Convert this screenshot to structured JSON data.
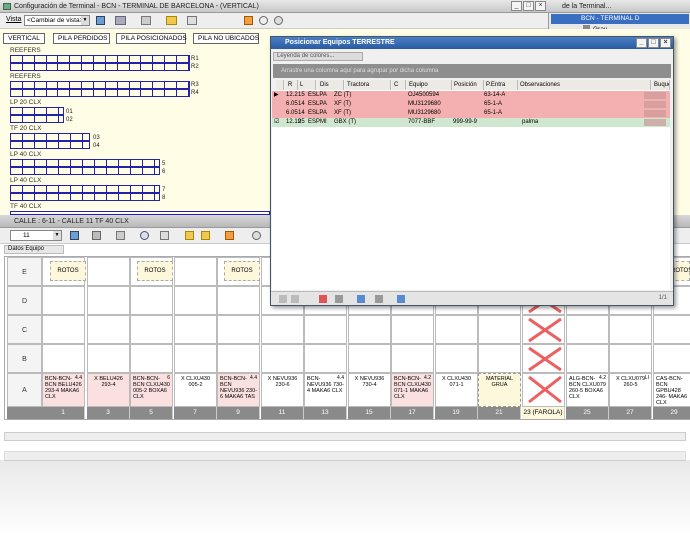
{
  "main_window": {
    "title": "Configuración de Terminal - BCN - TERMINAL DE BARCELONA - (VERTICAL)",
    "view_label": "Vista",
    "view_select": "<Cambiar de vista>"
  },
  "right_window": {
    "title": "de la Terminal...",
    "tree_item": "BCN - TERMINAL D",
    "tree_sub": "Gray"
  },
  "view_buttons": [
    "VERTICAL",
    "PILA PERDIDOS",
    "PILA POSICIONADOS",
    "PILA NO UBICADOS"
  ],
  "piles": [
    {
      "title": "REEFERS",
      "labels": [
        "R1",
        "R2"
      ]
    },
    {
      "title": "REEFERS",
      "labels": [
        "R3",
        "R4"
      ]
    },
    {
      "title": "LP 20 CLX",
      "labels": [
        "01",
        "02"
      ]
    },
    {
      "title": "TF 20 CLX",
      "labels": [
        "03",
        "04"
      ]
    },
    {
      "title": "LP 40 CLX",
      "labels": [
        "5",
        "6"
      ]
    },
    {
      "title": "LP 40 CLX",
      "labels": [
        "7",
        "8"
      ]
    },
    {
      "title": "TF 40 CLX",
      "labels": []
    }
  ],
  "calle": {
    "title": "CALLE : 6-11 - CALLE 11 TF 40 CLX",
    "select_value": "11",
    "datos_equipo": "Datos Equipo"
  },
  "row_labels": [
    "E",
    "D",
    "C",
    "B",
    "A"
  ],
  "rotos_label": "ROTOS",
  "a_row": [
    {
      "text": "BCN-BCN-BCN BELU426 293-4 MAKA6 CLX",
      "badge": "4.4",
      "type": "pink"
    },
    {
      "text": "X BELU426 293-4",
      "badge": "",
      "type": "pink"
    },
    {
      "text": "BCN-BCN-BCN CLXU430 005-2 BOXA6 CLX",
      "badge": "6",
      "type": "pink"
    },
    {
      "text": "X CLXU430 005-2",
      "badge": "",
      "type": "plain"
    },
    {
      "text": "BCN-BCN-BCN NEVU936 230-6 MAKA6 TAS",
      "badge": "4.4",
      "type": "pink"
    },
    {
      "text": "X NEVU936 230-6",
      "badge": "",
      "type": "plain"
    },
    {
      "text": "BCN- NEVU936 730-4 MAKA6 CLX",
      "badge": "4.4",
      "type": "plain"
    },
    {
      "text": "X NEVU936 730-4",
      "badge": "",
      "type": "plain"
    },
    {
      "text": "BCN-BCN-BCN CLXU430 071-1 MAKA6 CLX",
      "badge": "4.2",
      "type": "pink"
    },
    {
      "text": "X CLXU430 071-1",
      "badge": "",
      "type": "plain"
    },
    {
      "text": "MATERIAL GRUA",
      "badge": "",
      "type": "yellow"
    },
    {
      "text": "",
      "badge": "",
      "type": "cross"
    },
    {
      "text": "ALG-BCN-BCN CLXU079 260-5 BOXA6 CLX",
      "badge": "4.2",
      "type": "plain"
    },
    {
      "text": "X CLXU079 260-5",
      "badge": "LI",
      "type": "plain"
    },
    {
      "text": "CAS-BCN-BCN GPBU428 246- MAKA6 CLX",
      "badge": "",
      "type": "plain"
    }
  ],
  "column_numbers": [
    "1",
    "3",
    "5",
    "7",
    "9",
    "11",
    "13",
    "15",
    "17",
    "19",
    "21",
    "23 (FAROLA)",
    "25",
    "27",
    "29"
  ],
  "dialog": {
    "title": "Posicionar Equipos TERRESTRE",
    "legend": "Leyenda de colores...",
    "group_hint": "Arrastre una columna aquí para agrupar por dicha columna",
    "headers": [
      "R",
      "L",
      "Dis",
      "Tractora",
      "C",
      "Equipo",
      "Posición",
      "P.Entra",
      "Observaciones",
      "Buque"
    ],
    "rows": [
      {
        "marker": "▶",
        "l": "12.2",
        "dis": "15",
        "tractora": "ESLPA",
        "tractora2": "ZC (T)",
        "equipo": "OJ4500594",
        "posicion": "",
        "pentra": "63-14-A",
        "obs": "",
        "type": "pink"
      },
      {
        "marker": "",
        "l": "6.05",
        "dis": "14",
        "tractora": "ESLPA",
        "tractora2": "XF (T)",
        "equipo": "MU3129680",
        "posicion": "",
        "pentra": "65-1-A",
        "obs": "",
        "type": "pink"
      },
      {
        "marker": "",
        "l": "6.05",
        "dis": "14",
        "tractora": "ESLPA",
        "tractora2": "XF (T)",
        "equipo": "MU3129680",
        "posicion": "",
        "pentra": "65-1-A",
        "obs": "",
        "type": "pink"
      },
      {
        "marker": "☑",
        "l": "12.19",
        "dis": "25",
        "tractora": "ESPMI",
        "tractora2": "GBX (T)",
        "equipo": "7077-BBF",
        "posicion": "999-99-9",
        "pentra": "",
        "obs": "palma",
        "type": "green"
      }
    ],
    "page_info": "1/1"
  }
}
